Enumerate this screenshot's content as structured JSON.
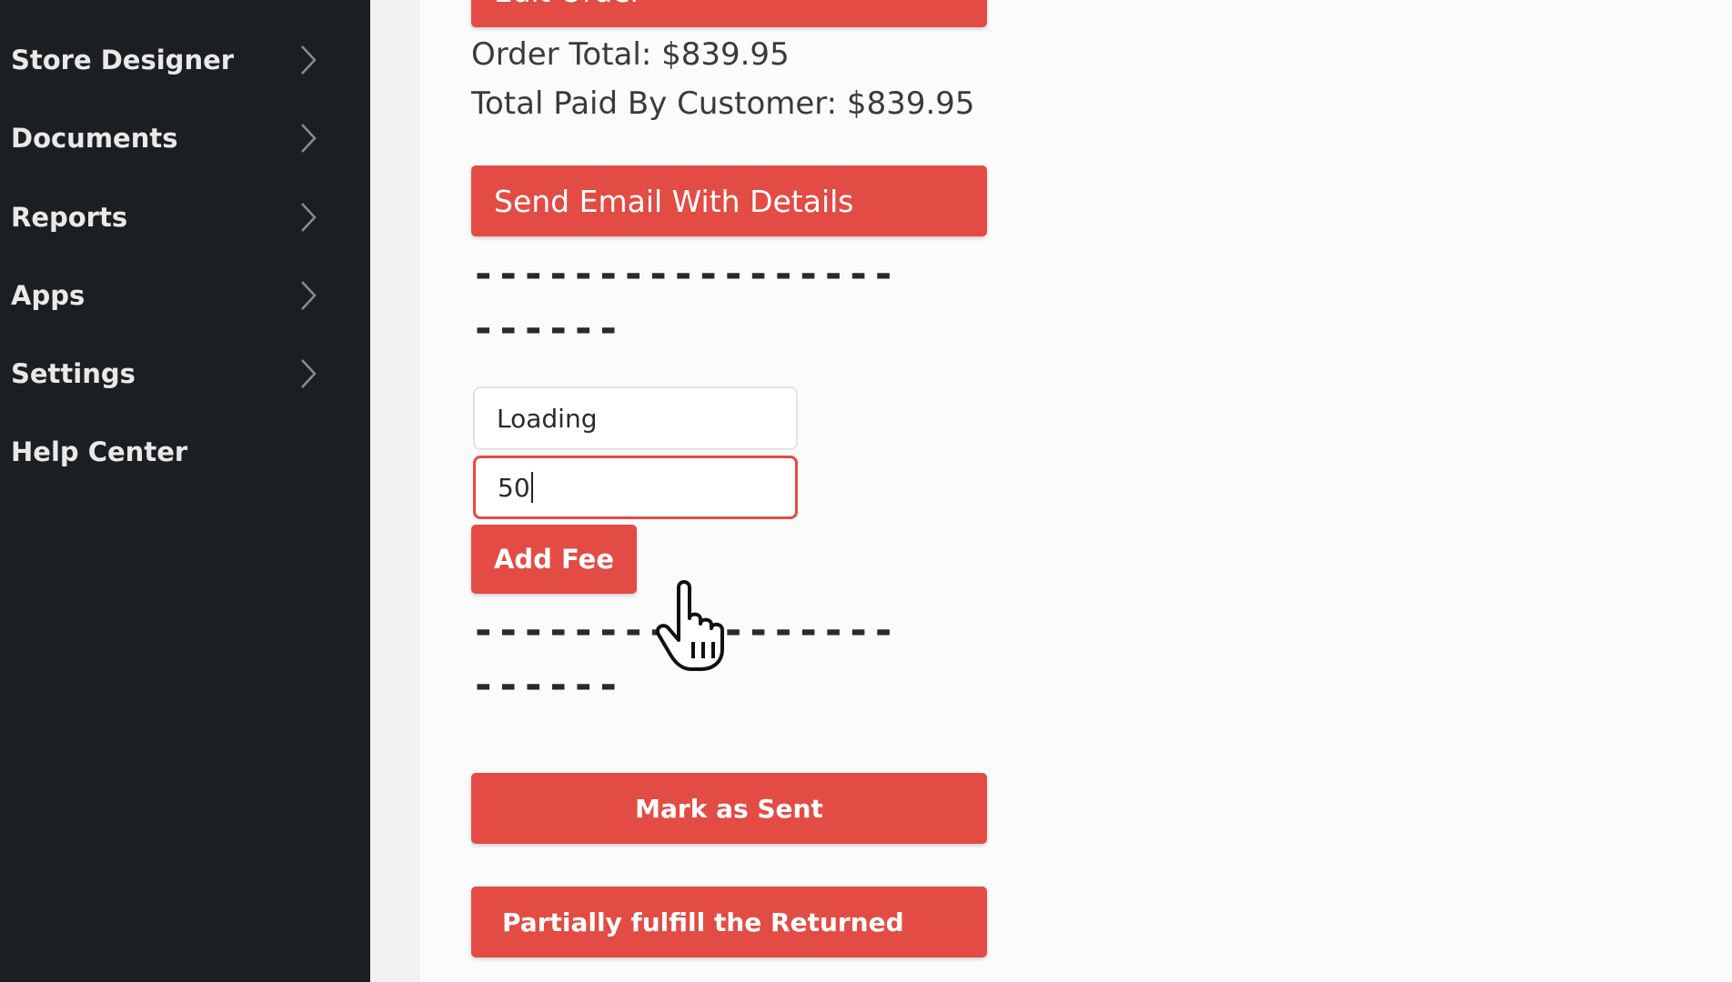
{
  "sidebar": {
    "items": [
      {
        "label": "Store Designer",
        "icon": "chevron-right-icon"
      },
      {
        "label": "Documents",
        "icon": "chevron-right-icon"
      },
      {
        "label": "Reports",
        "icon": "chevron-right-icon"
      },
      {
        "label": "Apps",
        "icon": "chevron-right-icon"
      },
      {
        "label": "Settings",
        "icon": "chevron-right-icon"
      },
      {
        "label": "Help Center"
      }
    ]
  },
  "order": {
    "edit_button_label": "Edit Order",
    "order_total": "Order Total: $839.95",
    "total_paid": "Total Paid By Customer: $839.95",
    "send_email_label": "Send Email With Details",
    "separator_top_1": "-----------------",
    "separator_top_2": "------",
    "fee_name_value": "Loading",
    "fee_amount_value": "50",
    "add_fee_label": "Add Fee",
    "separator_bottom_1": "-----------------",
    "separator_bottom_2": "------",
    "mark_sent_label": "Mark as Sent",
    "partial_fulfill_label": "Partially fulfill the Returned"
  },
  "colors": {
    "sidebar_bg": "#1c1f22",
    "accent": "#e24c44",
    "page_bg": "#fbfbfb"
  },
  "cursor": {
    "icon": "hand-pointer-icon"
  }
}
